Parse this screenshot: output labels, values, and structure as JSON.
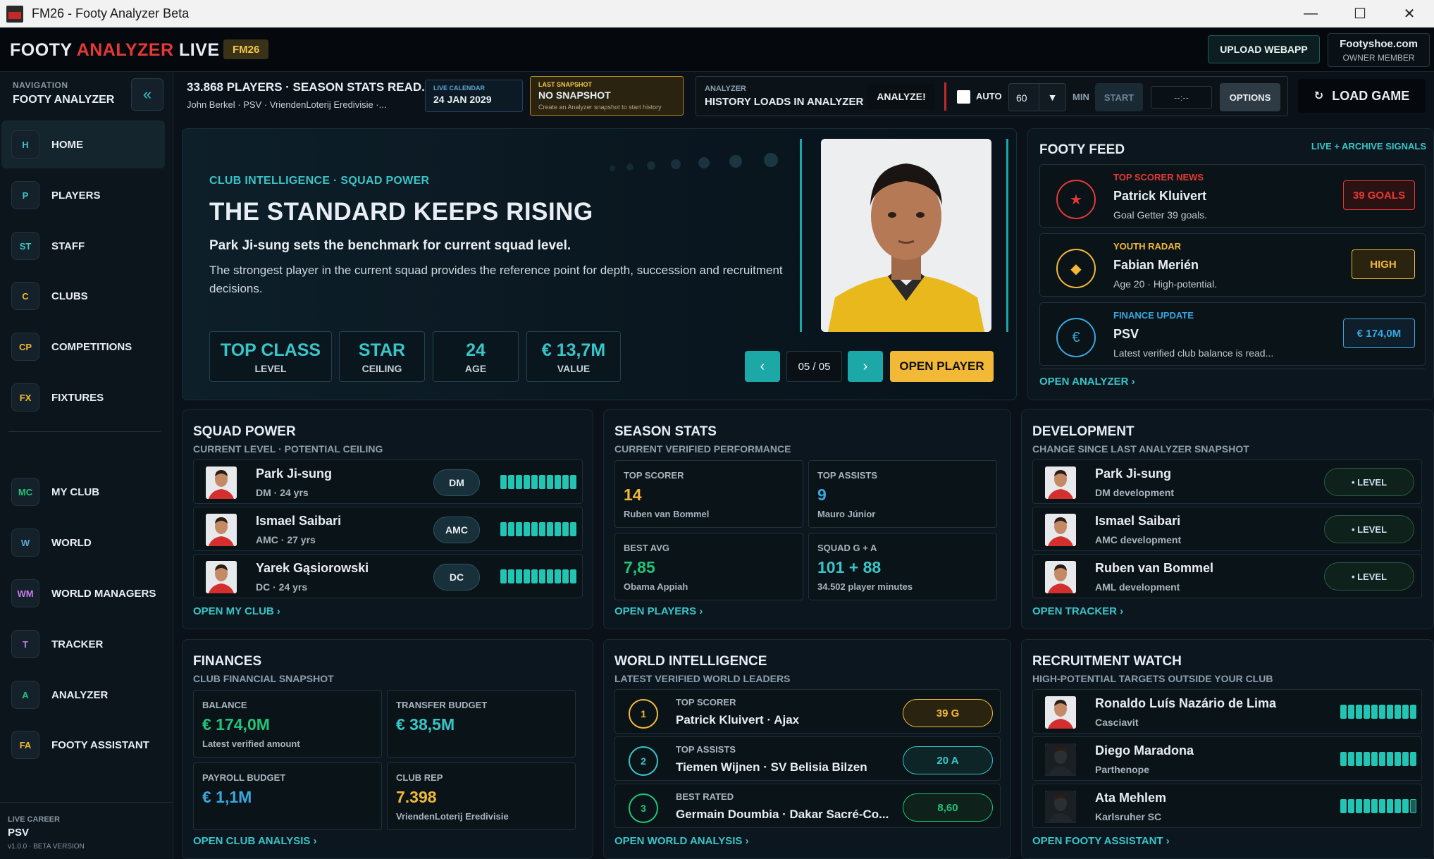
{
  "window": {
    "title": "FM26 - Footy Analyzer Beta"
  },
  "brand": {
    "part1": "FOOTY ",
    "part2": "ANALYZER",
    "part3": " LIVE",
    "badge": "FM26"
  },
  "header": {
    "upload": "UPLOAD WEBAPP",
    "owner_site": "Footyshoe.com",
    "owner_role": "OWNER MEMBER"
  },
  "sidebar": {
    "heading": "NAVIGATION",
    "title": "FOOTY ANALYZER",
    "items": [
      {
        "code": "H",
        "label": "HOME",
        "color": "#39c5c8"
      },
      {
        "code": "P",
        "label": "PLAYERS",
        "color": "#39c5c8"
      },
      {
        "code": "ST",
        "label": "STAFF",
        "color": "#39c5c8"
      },
      {
        "code": "C",
        "label": "CLUBS",
        "color": "#f2b937"
      },
      {
        "code": "CP",
        "label": "COMPETITIONS",
        "color": "#f2b937"
      },
      {
        "code": "FX",
        "label": "FIXTURES",
        "color": "#f2b937"
      },
      {
        "code": "MC",
        "label": "MY CLUB",
        "color": "#22c47a"
      },
      {
        "code": "W",
        "label": "WORLD",
        "color": "#5ba7d8"
      },
      {
        "code": "WM",
        "label": "WORLD MANAGERS",
        "color": "#c77de8"
      },
      {
        "code": "T",
        "label": "TRACKER",
        "color": "#c77de8"
      },
      {
        "code": "A",
        "label": "ANALYZER",
        "color": "#22c47a"
      },
      {
        "code": "FA",
        "label": "FOOTY ASSISTANT",
        "color": "#f2b937"
      }
    ],
    "career_label": "LIVE CAREER",
    "career_club": "PSV",
    "version": "v1.0.0 · BETA VERSION"
  },
  "status": {
    "summary": "33.868 PLAYERS · SEASON STATS READ...",
    "context": "John Berkel  ·  PSV  ·  VriendenLoterij Eredivisie  ·...",
    "calendar_label": "LIVE CALENDAR",
    "calendar_date": "24 JAN 2029",
    "snapshot_label": "LAST SNAPSHOT",
    "snapshot_value": "NO SNAPSHOT",
    "snapshot_hint": "Create an Analyzer snapshot to start history",
    "analyzer_label": "ANALYZER",
    "analyzer_value": "HISTORY LOADS IN ANALYZER",
    "analyze_btn": "ANALYZE!",
    "auto_label": "AUTO",
    "interval": "60",
    "min_label": "MIN",
    "start_btn": "START",
    "timer": "--:--",
    "options_btn": "OPTIONS",
    "load_btn": "LOAD GAME"
  },
  "hero": {
    "kicker": "CLUB INTELLIGENCE · SQUAD POWER",
    "headline": "THE STANDARD KEEPS RISING",
    "sub": "Park Ji-sung sets the benchmark for current squad level.",
    "desc": "The strongest player in the current squad provides the reference point for depth, succession and recruitment decisions.",
    "stats": [
      {
        "value": "TOP CLASS",
        "label": "LEVEL"
      },
      {
        "value": "STAR",
        "label": "CEILING"
      },
      {
        "value": "24",
        "label": "AGE"
      },
      {
        "value": "€ 13,7M",
        "label": "VALUE"
      }
    ],
    "prev": "‹",
    "next": "›",
    "counter": "05 / 05",
    "open_player": "OPEN PLAYER"
  },
  "feed": {
    "title": "FOOTY FEED",
    "tag": "LIVE + ARCHIVE SIGNALS",
    "items": [
      {
        "kicker": "TOP SCORER NEWS",
        "name": "Patrick Kluivert",
        "desc": "Goal Getter 39 goals.",
        "badge": "39 GOALS",
        "icon": "★",
        "color": "#e53935"
      },
      {
        "kicker": "YOUTH RADAR",
        "name": "Fabian Merién",
        "desc": "Age 20 · High-potential.",
        "badge": "HIGH",
        "icon": "◆",
        "color": "#f2b937"
      },
      {
        "kicker": "FINANCE UPDATE",
        "name": "PSV",
        "desc": "Latest verified club balance is read...",
        "badge": "€ 174,0M",
        "icon": "€",
        "color": "#39a8e0"
      }
    ],
    "link": "OPEN ANALYZER  ›"
  },
  "squad": {
    "title": "SQUAD POWER",
    "subtitle": "CURRENT LEVEL · POTENTIAL CEILING",
    "rows": [
      {
        "name": "Park Ji-sung",
        "meta": "DM · 24 yrs",
        "pos": "DM",
        "level": 10
      },
      {
        "name": "Ismael Saibari",
        "meta": "AMC · 27 yrs",
        "pos": "AMC",
        "level": 10
      },
      {
        "name": "Yarek Gąsiorowski",
        "meta": "DC · 24 yrs",
        "pos": "DC",
        "level": 10
      }
    ],
    "link": "OPEN MY CLUB  ›"
  },
  "season": {
    "title": "SEASON STATS",
    "subtitle": "CURRENT VERIFIED PERFORMANCE",
    "tiles": [
      {
        "label": "TOP SCORER",
        "value": "14",
        "detail": "Ruben van Bommel",
        "color": "#f2b937"
      },
      {
        "label": "TOP ASSISTS",
        "value": "9",
        "detail": "Mauro Júnior",
        "color": "#39a8e0"
      },
      {
        "label": "BEST AVG",
        "value": "7,85",
        "detail": "Obama Appiah",
        "color": "#22c47a"
      },
      {
        "label": "SQUAD G + A",
        "value": "101 + 88",
        "detail": "34.502 player minutes",
        "color": "#39c5c8"
      }
    ],
    "link": "OPEN PLAYERS  ›"
  },
  "development": {
    "title": "DEVELOPMENT",
    "subtitle": "CHANGE SINCE LAST ANALYZER SNAPSHOT",
    "rows": [
      {
        "name": "Park Ji-sung",
        "meta": "DM development",
        "badge": "• LEVEL"
      },
      {
        "name": "Ismael Saibari",
        "meta": "AMC development",
        "badge": "• LEVEL"
      },
      {
        "name": "Ruben van Bommel",
        "meta": "AML development",
        "badge": "• LEVEL"
      }
    ],
    "link": "OPEN TRACKER  ›"
  },
  "finances": {
    "title": "FINANCES",
    "subtitle": "CLUB FINANCIAL SNAPSHOT",
    "tiles": [
      {
        "label": "BALANCE",
        "value": "€ 174,0M",
        "detail": "Latest verified amount",
        "color": "#22c47a"
      },
      {
        "label": "TRANSFER BUDGET",
        "value": "€ 38,5M",
        "detail": "",
        "color": "#39c5c8"
      },
      {
        "label": "PAYROLL BUDGET",
        "value": "€ 1,1M",
        "detail": "",
        "color": "#39a8e0"
      },
      {
        "label": "CLUB REP",
        "value": "7.398",
        "detail": "VriendenLoterij Eredivisie",
        "color": "#f2b937"
      }
    ],
    "link": "OPEN CLUB ANALYSIS  ›"
  },
  "world": {
    "title": "WORLD INTELLIGENCE",
    "subtitle": "LATEST VERIFIED WORLD LEADERS",
    "rows": [
      {
        "rank": "1",
        "label": "TOP SCORER",
        "name": "Patrick Kluivert · Ajax",
        "badge": "39 G",
        "color": "#f2b937",
        "bg": "#2a2310"
      },
      {
        "rank": "2",
        "label": "TOP ASSISTS",
        "name": "Tiemen Wijnen · SV Belisia Bilzen",
        "badge": "20 A",
        "color": "#39c5c8",
        "bg": "#0e2528"
      },
      {
        "rank": "3",
        "label": "BEST RATED",
        "name": "Germain Doumbia · Dakar Sacré-Co...",
        "badge": "8,60",
        "color": "#22c47a",
        "bg": "#0e211b"
      }
    ],
    "link": "OPEN WORLD ANALYSIS  ›"
  },
  "recruitment": {
    "title": "RECRUITMENT WATCH",
    "subtitle": "HIGH-POTENTIAL TARGETS OUTSIDE YOUR CLUB",
    "rows": [
      {
        "name": "Ronaldo Luís Nazário de Lima",
        "meta": "Casciavit",
        "level": 10
      },
      {
        "name": "Diego Maradona",
        "meta": "Parthenope",
        "level": 10
      },
      {
        "name": "Ata Mehlem",
        "meta": "Karlsruher SC",
        "level": 9
      }
    ],
    "link": "OPEN FOOTY ASSISTANT  ›"
  }
}
